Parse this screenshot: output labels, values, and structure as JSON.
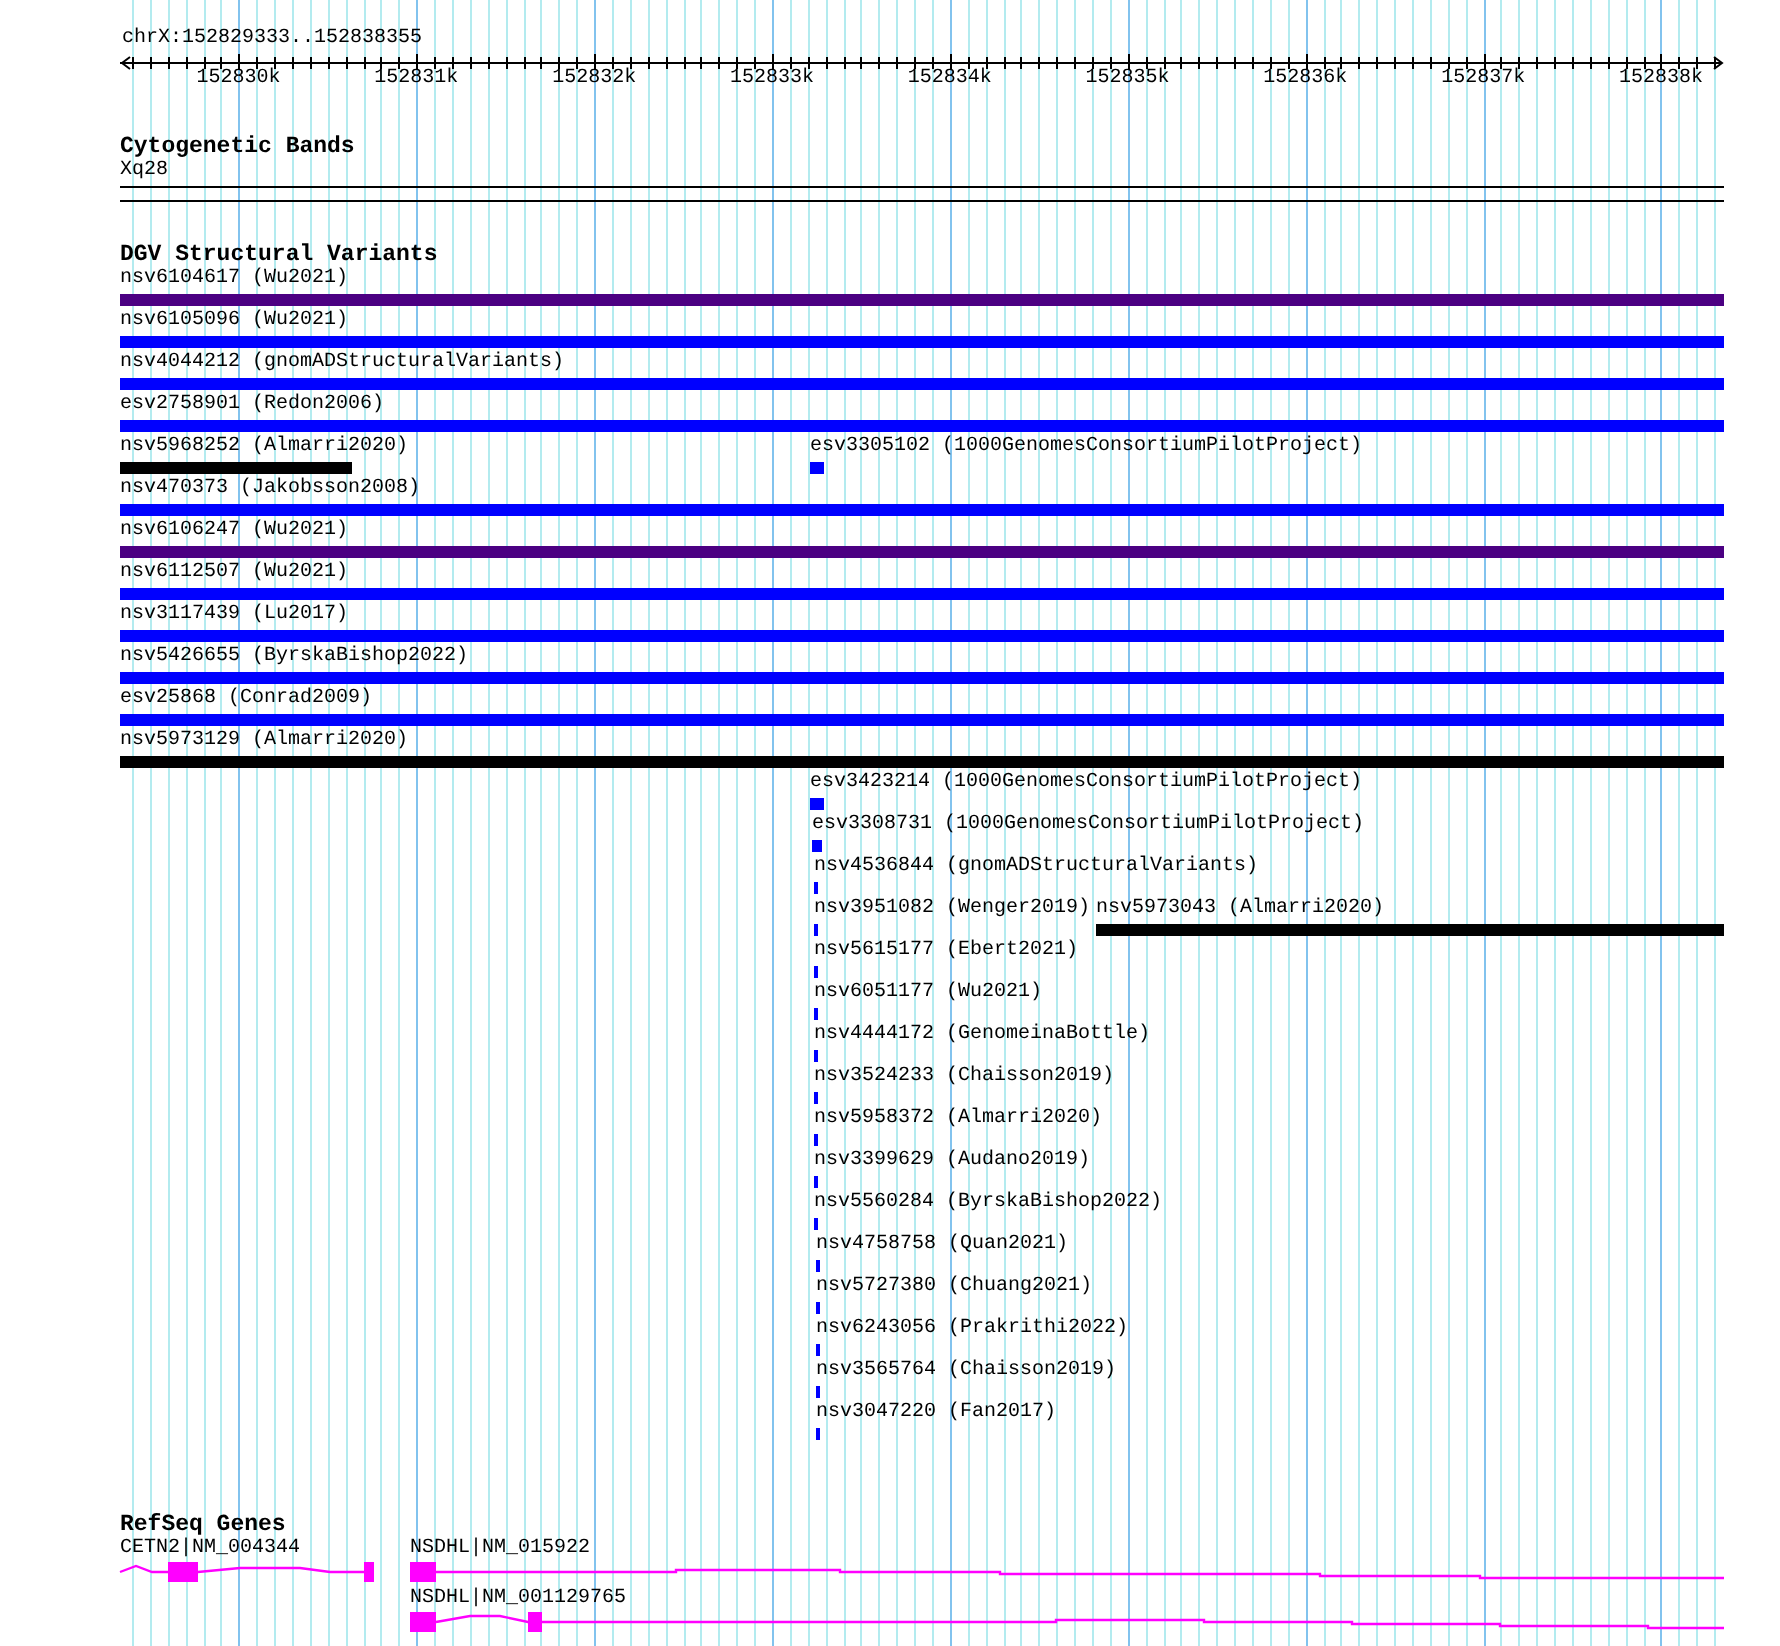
{
  "ruler": {
    "location": "chrX:152829333..152838355",
    "ticks": [
      "152830k",
      "152831k",
      "152832k",
      "152833k",
      "152834k",
      "152835k",
      "152836k",
      "152837k",
      "152838k"
    ]
  },
  "tracks": [
    {
      "kind": "bands",
      "title": "Cytogenetic Bands",
      "features": [
        {
          "label": "Xq28"
        }
      ]
    },
    {
      "kind": "variants",
      "title": "DGV Structural Variants",
      "features": [
        {
          "label": "nsv6104617 (Wu2021)",
          "color": "#4b0082"
        },
        {
          "label": "nsv6105096 (Wu2021)",
          "color": "#0000ff"
        },
        {
          "label": "nsv4044212 (gnomADStructuralVariants)",
          "color": "#0000ff"
        },
        {
          "label": "esv2758901 (Redon2006)",
          "color": "#0000ff"
        },
        {
          "label": "nsv5968252 (Almarri2020)",
          "color": "#000000"
        },
        {
          "label": "esv3305102 (1000GenomesConsortiumPilotProject)",
          "color": "#0000ff"
        },
        {
          "label": "nsv470373 (Jakobsson2008)",
          "color": "#0000ff"
        },
        {
          "label": "nsv6106247 (Wu2021)",
          "color": "#4b0082"
        },
        {
          "label": "nsv6112507 (Wu2021)",
          "color": "#0000ff"
        },
        {
          "label": "nsv3117439 (Lu2017)",
          "color": "#0000ff"
        },
        {
          "label": "nsv5426655 (ByrskaBishop2022)",
          "color": "#0000ff"
        },
        {
          "label": "esv25868 (Conrad2009)",
          "color": "#0000ff"
        },
        {
          "label": "nsv5973129 (Almarri2020)",
          "color": "#000000"
        },
        {
          "label": "esv3423214 (1000GenomesConsortiumPilotProject)",
          "color": "#0000ff"
        },
        {
          "label": "esv3308731 (1000GenomesConsortiumPilotProject)",
          "color": "#0000ff"
        },
        {
          "label": "nsv4536844 (gnomADStructuralVariants)",
          "color": "#0000ff"
        },
        {
          "label": "nsv3951082 (Wenger2019)",
          "color": "#0000ff"
        },
        {
          "label": "nsv5973043 (Almarri2020)",
          "color": "#000000"
        },
        {
          "label": "nsv5615177 (Ebert2021)",
          "color": "#0000ff"
        },
        {
          "label": "nsv6051177 (Wu2021)",
          "color": "#0000ff"
        },
        {
          "label": "nsv4444172 (GenomeinaBottle)",
          "color": "#0000ff"
        },
        {
          "label": "nsv3524233 (Chaisson2019)",
          "color": "#0000ff"
        },
        {
          "label": "nsv5958372 (Almarri2020)",
          "color": "#0000ff"
        },
        {
          "label": "nsv3399629 (Audano2019)",
          "color": "#0000ff"
        },
        {
          "label": "nsv5560284 (ByrskaBishop2022)",
          "color": "#0000ff"
        },
        {
          "label": "nsv4758758 (Quan2021)",
          "color": "#0000ff"
        },
        {
          "label": "nsv5727380 (Chuang2021)",
          "color": "#0000ff"
        },
        {
          "label": "nsv6243056 (Prakrithi2022)",
          "color": "#0000ff"
        },
        {
          "label": "nsv3565764 (Chaisson2019)",
          "color": "#0000ff"
        },
        {
          "label": "nsv3047220 (Fan2017)",
          "color": "#0000ff"
        }
      ]
    },
    {
      "kind": "genes",
      "title": "RefSeq Genes",
      "features": [
        {
          "label": "CETN2|NM_004344"
        },
        {
          "label": "NSDHL|NM_015922"
        },
        {
          "label": "NSDHL|NM_001129765"
        }
      ]
    }
  ]
}
